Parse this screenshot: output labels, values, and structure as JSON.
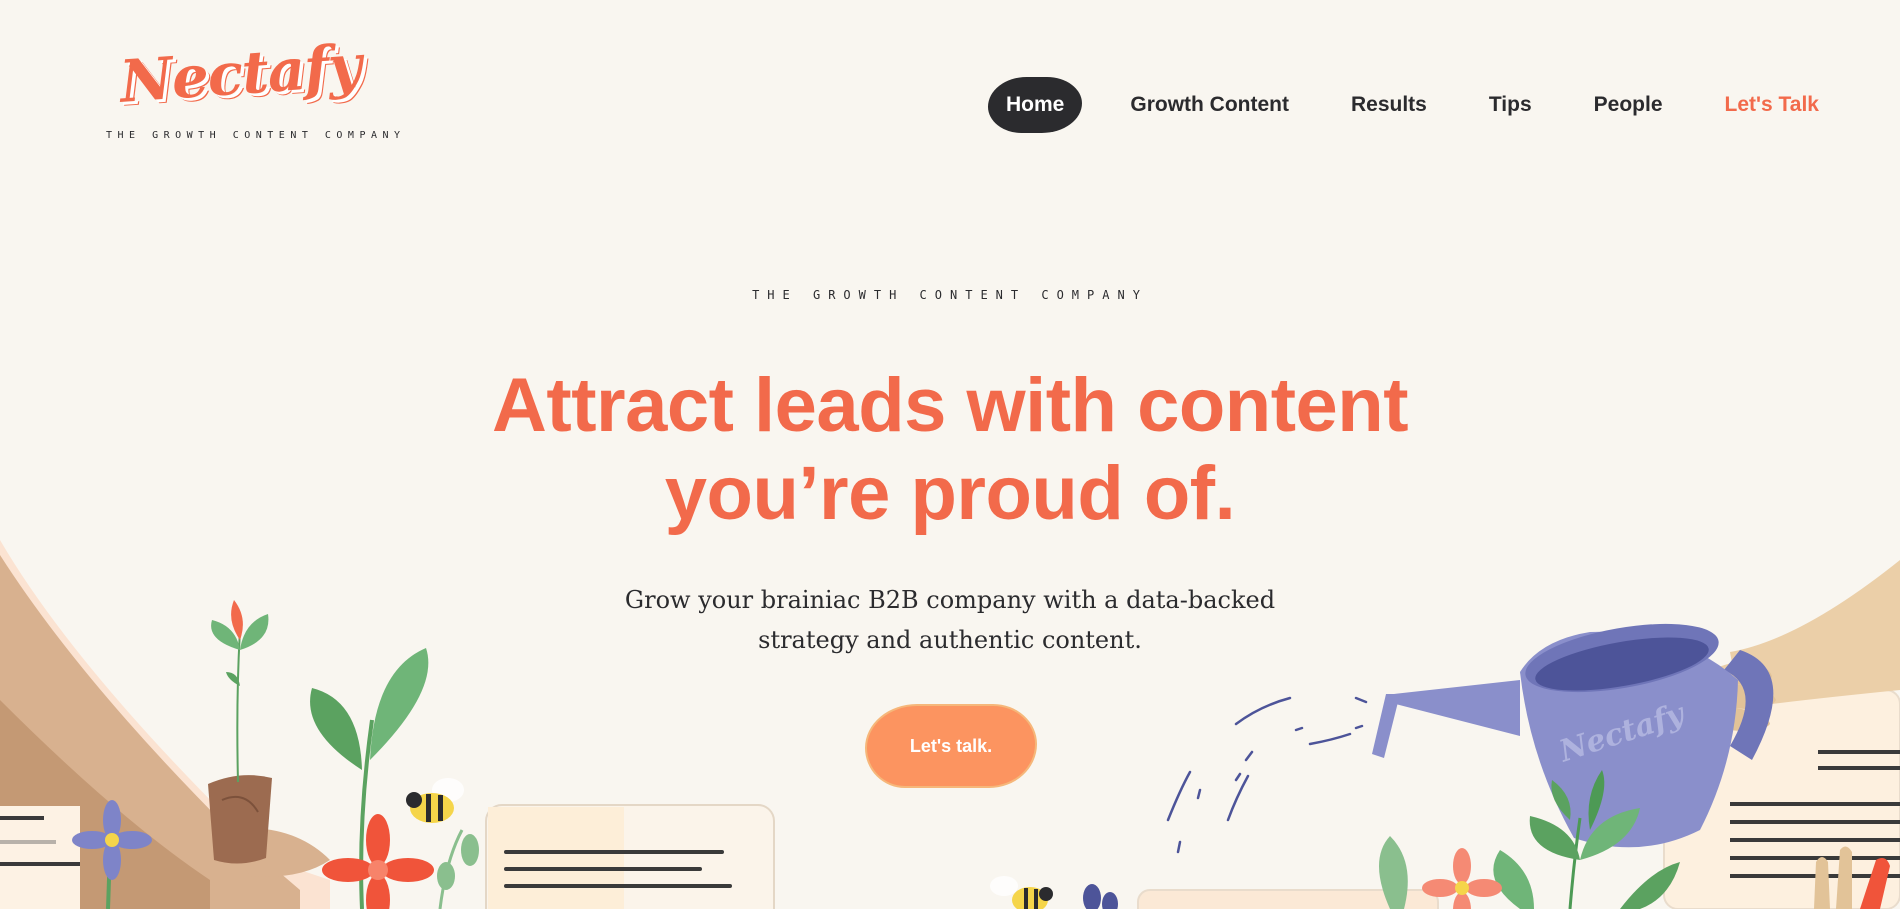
{
  "brand": {
    "logo_text": "Nectafy",
    "tagline": "THE GROWTH CONTENT COMPANY",
    "watering_can_logo": "Nectafy",
    "colors": {
      "accent": "#f26a4b",
      "cta": "#fc9460",
      "nav_active": "#2b2b2e",
      "background": "#f9f6f0",
      "can": "#8a8fcb"
    }
  },
  "nav": {
    "items": [
      {
        "label": "Home",
        "active": true
      },
      {
        "label": "Growth Content"
      },
      {
        "label": "Results"
      },
      {
        "label": "Tips"
      },
      {
        "label": "People"
      },
      {
        "label": "Let's Talk",
        "highlight": true
      }
    ]
  },
  "hero": {
    "eyebrow": "THE GROWTH CONTENT COMPANY",
    "headline_line1": "Attract leads with content",
    "headline_line2": "you’re proud of.",
    "subline_line1": "Grow your brainiac B2B company with a data-backed",
    "subline_line2": "strategy and authentic content.",
    "cta_label": "Let's talk."
  },
  "icons": [
    "hand-holding-pot-icon",
    "watering-can-icon",
    "flower-icon",
    "bee-icon",
    "leaf-icon",
    "document-card-icon"
  ]
}
